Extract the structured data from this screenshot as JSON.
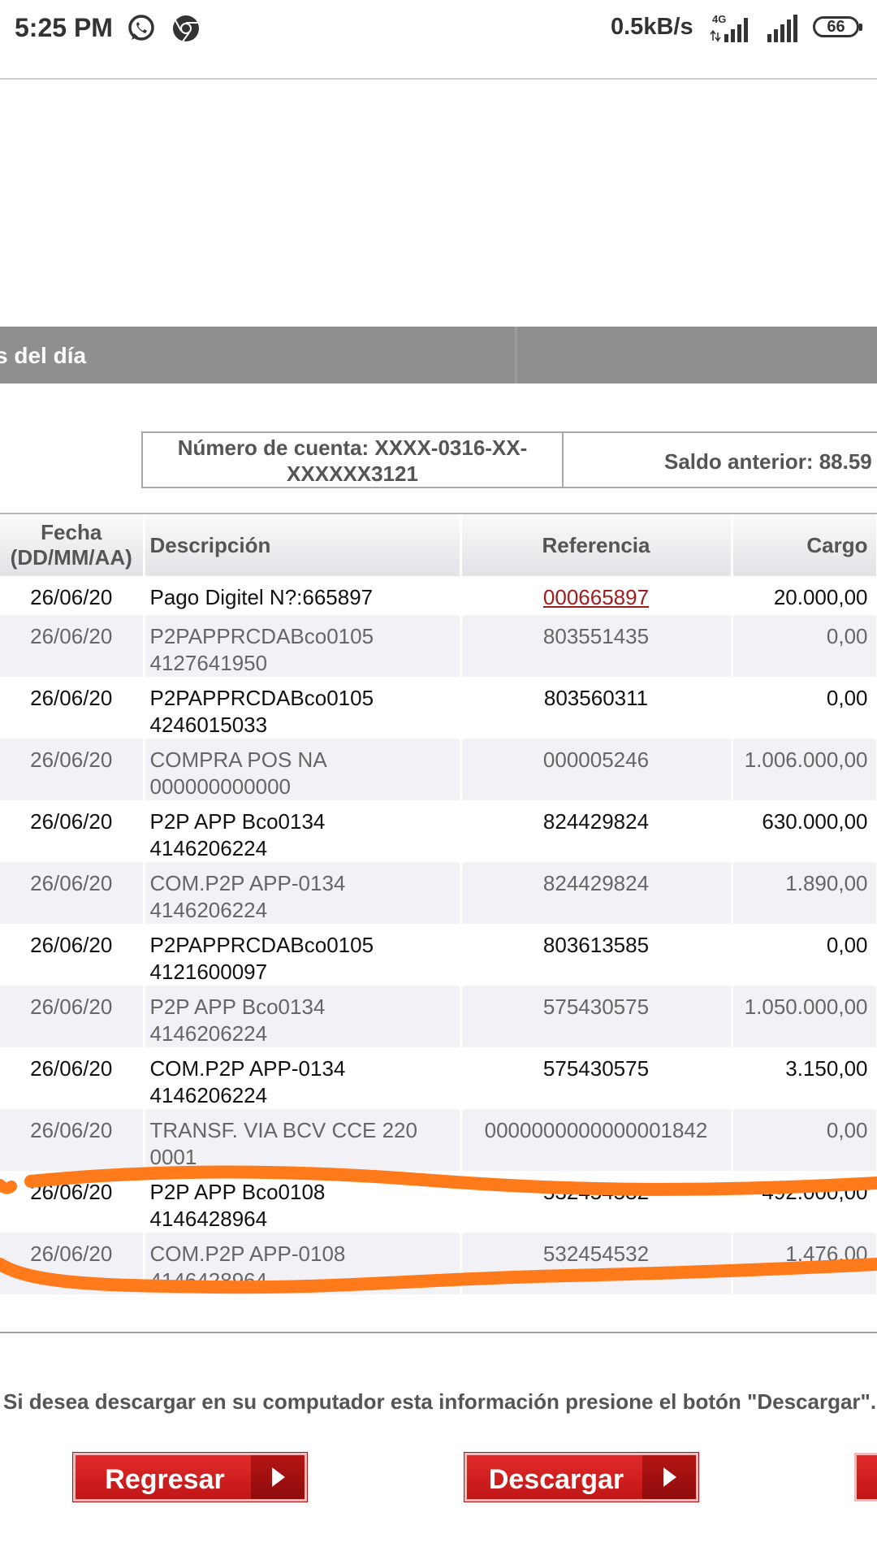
{
  "status_bar": {
    "time": "5:25 PM",
    "net_speed": "0.5kB/s",
    "net_type": "4G",
    "battery": "66",
    "icons": [
      "whatsapp-icon",
      "chrome-icon",
      "signal-icon",
      "signal-icon",
      "battery-icon"
    ]
  },
  "section": {
    "title": "s del día"
  },
  "account": {
    "number_line1": "Número de cuenta: XXXX-0316-XX-",
    "number_line2": "XXXXXX3121",
    "saldo_anterior": "Saldo anterior: 88.59"
  },
  "table": {
    "headers": {
      "fecha_1": "Fecha",
      "fecha_2": "(DD/MM/AA)",
      "descripcion": "Descripción",
      "referencia": "Referencia",
      "cargo": "Cargo"
    },
    "rows": [
      {
        "fecha": "26/06/20",
        "desc1": "Pago Digitel N?:665897",
        "desc2": "",
        "ref": "000665897",
        "cargo": "20.000,00"
      },
      {
        "fecha": "26/06/20",
        "desc1": "P2PAPPRCDABco0105",
        "desc2": "4127641950",
        "ref": "803551435",
        "cargo": "0,00"
      },
      {
        "fecha": "26/06/20",
        "desc1": "P2PAPPRCDABco0105",
        "desc2": "4246015033",
        "ref": "803560311",
        "cargo": "0,00"
      },
      {
        "fecha": "26/06/20",
        "desc1": "COMPRA POS NA",
        "desc2": "000000000000",
        "ref": "000005246",
        "cargo": "1.006.000,00"
      },
      {
        "fecha": "26/06/20",
        "desc1": "P2P APP Bco0134",
        "desc2": "4146206224",
        "ref": "824429824",
        "cargo": "630.000,00"
      },
      {
        "fecha": "26/06/20",
        "desc1": "COM.P2P APP-0134",
        "desc2": "4146206224",
        "ref": "824429824",
        "cargo": "1.890,00"
      },
      {
        "fecha": "26/06/20",
        "desc1": "P2PAPPRCDABco0105",
        "desc2": "4121600097",
        "ref": "803613585",
        "cargo": "0,00"
      },
      {
        "fecha": "26/06/20",
        "desc1": "P2P APP Bco0134",
        "desc2": "4146206224",
        "ref": "575430575",
        "cargo": "1.050.000,00"
      },
      {
        "fecha": "26/06/20",
        "desc1": "COM.P2P APP-0134",
        "desc2": "4146206224",
        "ref": "575430575",
        "cargo": "3.150,00"
      },
      {
        "fecha": "26/06/20",
        "desc1": "TRANSF. VIA BCV CCE 220",
        "desc2": "0001",
        "ref": "0000000000000001842",
        "cargo": "0,00"
      },
      {
        "fecha": "26/06/20",
        "desc1": "P2P APP Bco0108",
        "desc2": "4146428964",
        "ref": "532454532",
        "cargo": "492.000,00"
      },
      {
        "fecha": "26/06/20",
        "desc1": "COM.P2P APP-0108",
        "desc2": "4146428964",
        "ref": "532454532",
        "cargo": "1.476,00"
      }
    ]
  },
  "download_message": "Si desea descargar en su computador esta información presione el botón \"Descargar\".",
  "buttons": {
    "back": "Regresar",
    "download": "Descargar"
  },
  "colors": {
    "accent_red": "#c81a1a",
    "annotation_orange": "#ff7a1a",
    "header_gray": "#8f8f8f"
  }
}
